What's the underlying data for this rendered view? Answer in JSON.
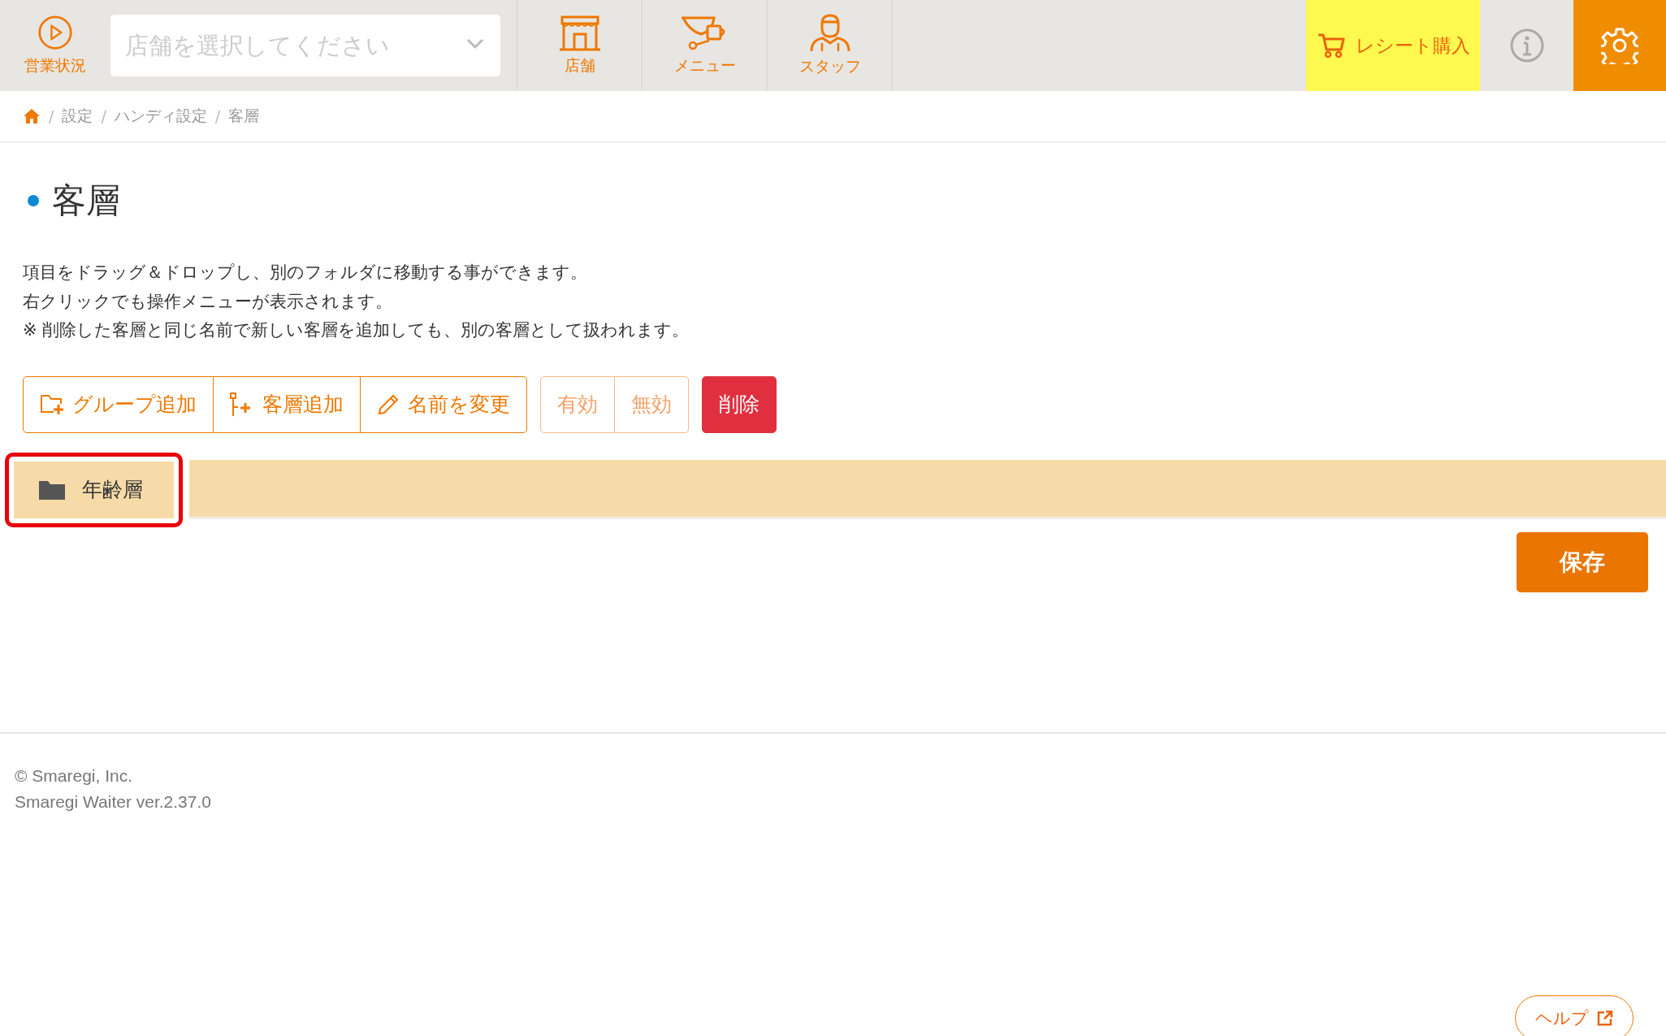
{
  "header": {
    "status": {
      "label": "営業状況"
    },
    "store_select": {
      "placeholder": "店舗を選択してください"
    },
    "nav": [
      {
        "kind": "store",
        "label": "店舗"
      },
      {
        "kind": "menu",
        "label": "メニュー"
      },
      {
        "kind": "staff",
        "label": "スタッフ"
      }
    ],
    "receipt_button": {
      "label": "レシート購入"
    },
    "settings_selected": true
  },
  "breadcrumb": {
    "separator": "/",
    "items": [
      "設定",
      "ハンディ設定",
      "客層"
    ]
  },
  "title": "客層",
  "description": [
    "項目をドラッグ＆ドロップし、別のフォルダに移動する事ができます。",
    "右クリックでも操作メニューが表示されます。",
    "※ 削除した客層と同じ名前で新しい客層を追加しても、別の客層として扱われます。"
  ],
  "toolbar": [
    [
      {
        "kind": "group-add",
        "label": "グループ追加",
        "disabled": false
      },
      {
        "kind": "item-add",
        "label": "客層追加",
        "disabled": false
      },
      {
        "kind": "rename",
        "label": "名前を変更",
        "disabled": false
      }
    ],
    [
      {
        "kind": "enable",
        "label": "有効",
        "disabled": true
      },
      {
        "kind": "disable",
        "label": "無効",
        "disabled": true
      }
    ],
    [
      {
        "kind": "delete",
        "label": "削除",
        "disabled": false
      }
    ]
  ],
  "tree": [
    {
      "label": "年齢層",
      "selected": true,
      "highlighted": true
    }
  ],
  "save_button": "保存",
  "footer": [
    "© Smaregi, Inc.",
    "Smaregi Waiter ver.2.37.0"
  ],
  "help_button": "ヘルプ"
}
